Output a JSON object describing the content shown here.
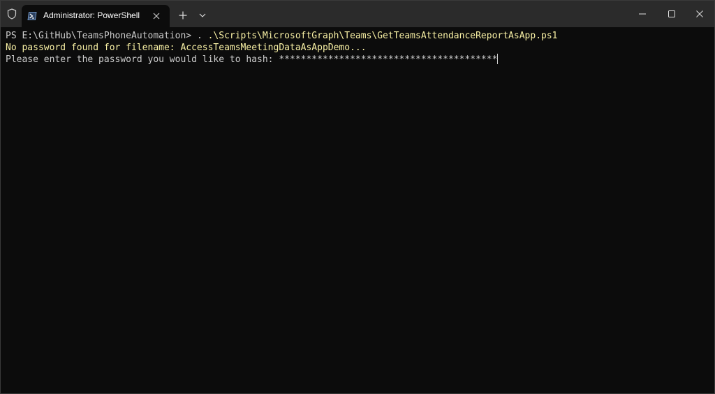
{
  "window": {
    "tab_title": "Administrator: PowerShell",
    "icons": {
      "shield": "shield-icon",
      "powershell": "powershell-icon",
      "tab_close": "close-icon",
      "new_tab": "plus-icon",
      "dropdown": "chevron-down-icon",
      "minimize": "minimize-icon",
      "maximize": "maximize-icon",
      "close": "close-icon"
    }
  },
  "terminal": {
    "prompt": "PS E:\\GitHub\\TeamsPhoneAutomation> ",
    "command_dot": ". ",
    "command_path": ".\\Scripts\\MicrosoftGraph\\Teams\\GetTeamsAttendanceReportAsApp.ps1",
    "warning_line": "No password found for filename: AccessTeamsMeetingDataAsAppDemo...",
    "input_prompt": "Please enter the password you would like to hash: ",
    "input_value": "****************************************"
  },
  "colors": {
    "background": "#0c0c0c",
    "titlebar": "#2b2b2b",
    "text": "#cccccc",
    "highlight_yellow": "#f9f1a5"
  }
}
